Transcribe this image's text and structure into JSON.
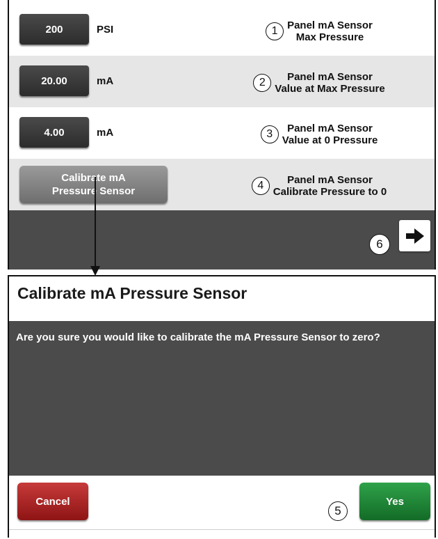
{
  "settings": {
    "rows": [
      {
        "value": "200",
        "unit": "PSI",
        "callout": "1",
        "description_line1": "Panel mA Sensor",
        "description_line2": "Max Pressure"
      },
      {
        "value": "20.00",
        "unit": "mA",
        "callout": "2",
        "description_line1": "Panel mA Sensor",
        "description_line2": "Value at Max Pressure"
      },
      {
        "value": "4.00",
        "unit": "mA",
        "callout": "3",
        "description_line1": "Panel mA Sensor",
        "description_line2": "Value at 0 Pressure"
      }
    ],
    "calibrate": {
      "button_line1": "Calibrate mA",
      "button_line2": "Pressure Sensor",
      "callout": "4",
      "description_line1": "Panel mA Sensor",
      "description_line2": "Calibrate Pressure to 0"
    },
    "next": {
      "icon": "arrow-right-icon",
      "callout": "6"
    }
  },
  "dialog": {
    "title": "Calibrate mA Pressure Sensor",
    "message": "Are you sure you would like to calibrate the mA Pressure Sensor to zero?",
    "cancel_label": "Cancel",
    "yes_label": "Yes",
    "yes_callout": "5"
  },
  "colors": {
    "panel_dark": "#4b4b4b",
    "row_alt": "#e6e6e6",
    "cancel": "#a32020",
    "yes": "#1f8a37",
    "value_box": "#3a3a3a"
  }
}
